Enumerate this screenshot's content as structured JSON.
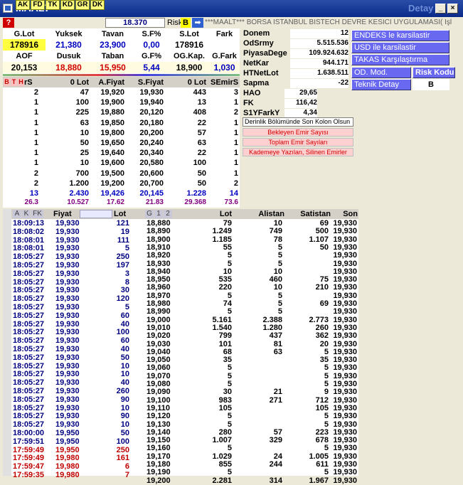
{
  "window": {
    "title": "MAALT",
    "detay": "Detay"
  },
  "toolbar": {
    "buttons": [
      "AK",
      "FD",
      "TK",
      "KD",
      "GR",
      "DK"
    ],
    "price": "18.370",
    "risk_label": "Risk",
    "risk_value": "B",
    "ticker": "***MAALT*** BORSA İSTANBUL BISTECH DEVRE KESİCİ UYGULAMASI( İşl"
  },
  "summary": {
    "row1_labels": [
      "G.Lot",
      "Yuksek",
      "Tavan",
      "S.F%",
      "S.Lot",
      "Fark"
    ],
    "row1_values": [
      "178916",
      "21,380",
      "23,900",
      "0,00",
      "178916",
      ""
    ],
    "row2_labels": [
      "AOF",
      "Dusuk",
      "Taban",
      "G.F%",
      "OG.Kap.",
      "G.Fark"
    ],
    "row2_values": [
      "20,153",
      "18,880",
      "15,950",
      "5,44",
      "18,900",
      "1,030"
    ]
  },
  "depth": {
    "headers": [
      "B",
      "T",
      "H",
      "rS",
      "0 Lot",
      "A.Fiyat",
      "S.Fiyat",
      "0 Lot",
      "SEmirS"
    ],
    "rows": [
      [
        "2",
        "47",
        "19,920",
        "19,930",
        "443",
        "3"
      ],
      [
        "1",
        "100",
        "19,900",
        "19,940",
        "13",
        "1"
      ],
      [
        "1",
        "225",
        "19,880",
        "20,120",
        "408",
        "2"
      ],
      [
        "1",
        "63",
        "19,850",
        "20,180",
        "22",
        "1"
      ],
      [
        "1",
        "10",
        "19,800",
        "20,200",
        "57",
        "1"
      ],
      [
        "1",
        "50",
        "19,650",
        "20,240",
        "63",
        "1"
      ],
      [
        "1",
        "25",
        "19,640",
        "20,340",
        "22",
        "1"
      ],
      [
        "1",
        "10",
        "19,600",
        "20,580",
        "100",
        "1"
      ],
      [
        "2",
        "700",
        "19,500",
        "20,600",
        "50",
        "1"
      ],
      [
        "2",
        "1.200",
        "19,200",
        "20,700",
        "50",
        "2"
      ]
    ],
    "totals": [
      "13",
      "2.430",
      "19,426",
      "20,145",
      "1.228",
      "14"
    ],
    "totals2": [
      "26.3",
      "10.527",
      "17.62",
      "21.83",
      "29.368",
      "73.6"
    ]
  },
  "info": {
    "rows": [
      [
        "Donem",
        "12"
      ],
      [
        "OdSrmy",
        "5.515.536"
      ],
      [
        "PiyasaDege",
        "109.924.632"
      ],
      [
        "NetKar",
        "944.171"
      ],
      [
        "HTNetLot",
        "1.638.511"
      ],
      [
        "Sapma",
        "-22"
      ]
    ],
    "rows2": [
      [
        "HAO",
        "29,65"
      ],
      [
        "FK",
        "116,42"
      ],
      [
        "S1YFarkY",
        "4,34"
      ]
    ]
  },
  "buttons": {
    "endeks": "ENDEKS le karsilastir",
    "usd": "USD ile karsilastir",
    "takas": "TAKAS Karşılaştırma",
    "od_mod": "OD. Mod.",
    "risk_kodu": "Risk Kodu",
    "teknik": "Teknik Detay",
    "risk_val": "B"
  },
  "menu": {
    "derinlik": "Derinlik Bölümünde Son Kolon Olsun",
    "bekleyen": "Bekleyen Emir Sayısı",
    "toplam": "Toplam Emir Sayıları",
    "kademe": "Kademeye Yazılan, Silinen Emirler"
  },
  "trades": {
    "tabs": [
      "A",
      "K",
      "FK"
    ],
    "headers": [
      "Fiyat",
      "Lot"
    ],
    "rows": [
      [
        "18:09:13",
        "19,930",
        "121",
        "b"
      ],
      [
        "18:08:02",
        "19,930",
        "19",
        "b"
      ],
      [
        "18:08:01",
        "19,930",
        "111",
        "b"
      ],
      [
        "18:08:01",
        "19,930",
        "5",
        "b"
      ],
      [
        "18:05:27",
        "19,930",
        "250",
        "b"
      ],
      [
        "18:05:27",
        "19,930",
        "197",
        "b"
      ],
      [
        "18:05:27",
        "19,930",
        "3",
        "b"
      ],
      [
        "18:05:27",
        "19,930",
        "8",
        "b"
      ],
      [
        "18:05:27",
        "19,930",
        "30",
        "b"
      ],
      [
        "18:05:27",
        "19,930",
        "120",
        "b"
      ],
      [
        "18:05:27",
        "19,930",
        "5",
        "b"
      ],
      [
        "18:05:27",
        "19,930",
        "60",
        "b"
      ],
      [
        "18:05:27",
        "19,930",
        "40",
        "b"
      ],
      [
        "18:05:27",
        "19,930",
        "100",
        "b"
      ],
      [
        "18:05:27",
        "19,930",
        "60",
        "b"
      ],
      [
        "18:05:27",
        "19,930",
        "40",
        "b"
      ],
      [
        "18:05:27",
        "19,930",
        "50",
        "b"
      ],
      [
        "18:05:27",
        "19,930",
        "10",
        "b"
      ],
      [
        "18:05:27",
        "19,930",
        "10",
        "b"
      ],
      [
        "18:05:27",
        "19,930",
        "40",
        "b"
      ],
      [
        "18:05:27",
        "19,930",
        "260",
        "b"
      ],
      [
        "18:05:27",
        "19,930",
        "90",
        "b"
      ],
      [
        "18:05:27",
        "19,930",
        "10",
        "b"
      ],
      [
        "18:05:27",
        "19,930",
        "90",
        "b"
      ],
      [
        "18:05:27",
        "19,930",
        "10",
        "b"
      ],
      [
        "18:00:00",
        "19,950",
        "50",
        "b"
      ],
      [
        "17:59:51",
        "19,950",
        "100",
        "b"
      ],
      [
        "17:59:49",
        "19,950",
        "250",
        "r"
      ],
      [
        "17:59:49",
        "19,980",
        "161",
        "r"
      ],
      [
        "17:59:47",
        "19,980",
        "6",
        "r"
      ],
      [
        "17:59:35",
        "19,980",
        "7",
        "r"
      ]
    ]
  },
  "volume": {
    "tabs": [
      "G",
      "1",
      "2"
    ],
    "headers": [
      "Lot",
      "Alistan",
      "Satistan",
      "Son"
    ],
    "rows": [
      [
        "18,880",
        "79",
        "10",
        "69",
        "19,930"
      ],
      [
        "18,890",
        "1.249",
        "749",
        "500",
        "19,930"
      ],
      [
        "18,900",
        "1.185",
        "78",
        "1.107",
        "19,930"
      ],
      [
        "18,910",
        "55",
        "5",
        "50",
        "19,930"
      ],
      [
        "18,920",
        "5",
        "5",
        "",
        "19,930"
      ],
      [
        "18,930",
        "5",
        "5",
        "",
        "19,930"
      ],
      [
        "18,940",
        "10",
        "10",
        "",
        "19,930"
      ],
      [
        "18,950",
        "535",
        "460",
        "75",
        "19,930"
      ],
      [
        "18,960",
        "220",
        "10",
        "210",
        "19,930"
      ],
      [
        "18,970",
        "5",
        "5",
        "",
        "19,930"
      ],
      [
        "18,980",
        "74",
        "5",
        "69",
        "19,930"
      ],
      [
        "18,990",
        "5",
        "5",
        "",
        "19,930"
      ],
      [
        "19,000",
        "5.161",
        "2.388",
        "2.773",
        "19,930"
      ],
      [
        "19,010",
        "1.540",
        "1.280",
        "260",
        "19,930"
      ],
      [
        "19,020",
        "799",
        "437",
        "362",
        "19,930"
      ],
      [
        "19,030",
        "101",
        "81",
        "20",
        "19,930"
      ],
      [
        "19,040",
        "68",
        "63",
        "5",
        "19,930"
      ],
      [
        "19,050",
        "35",
        "",
        "35",
        "19,930"
      ],
      [
        "19,060",
        "5",
        "",
        "5",
        "19,930"
      ],
      [
        "19,070",
        "5",
        "",
        "5",
        "19,930"
      ],
      [
        "19,080",
        "5",
        "",
        "5",
        "19,930"
      ],
      [
        "19,090",
        "30",
        "21",
        "9",
        "19,930"
      ],
      [
        "19,100",
        "983",
        "271",
        "712",
        "19,930"
      ],
      [
        "19,110",
        "105",
        "",
        "105",
        "19,930"
      ],
      [
        "19,120",
        "5",
        "",
        "5",
        "19,930"
      ],
      [
        "19,130",
        "5",
        "",
        "5",
        "19,930"
      ],
      [
        "19,140",
        "280",
        "57",
        "223",
        "19,930"
      ],
      [
        "19,150",
        "1.007",
        "329",
        "678",
        "19,930"
      ],
      [
        "19,160",
        "5",
        "",
        "5",
        "19,930"
      ],
      [
        "19,170",
        "1.029",
        "24",
        "1.005",
        "19,930"
      ],
      [
        "19,180",
        "855",
        "244",
        "611",
        "19,930"
      ],
      [
        "19,190",
        "5",
        "",
        "5",
        "19,930"
      ],
      [
        "19,200",
        "2.281",
        "314",
        "1.967",
        "19,930"
      ]
    ]
  }
}
